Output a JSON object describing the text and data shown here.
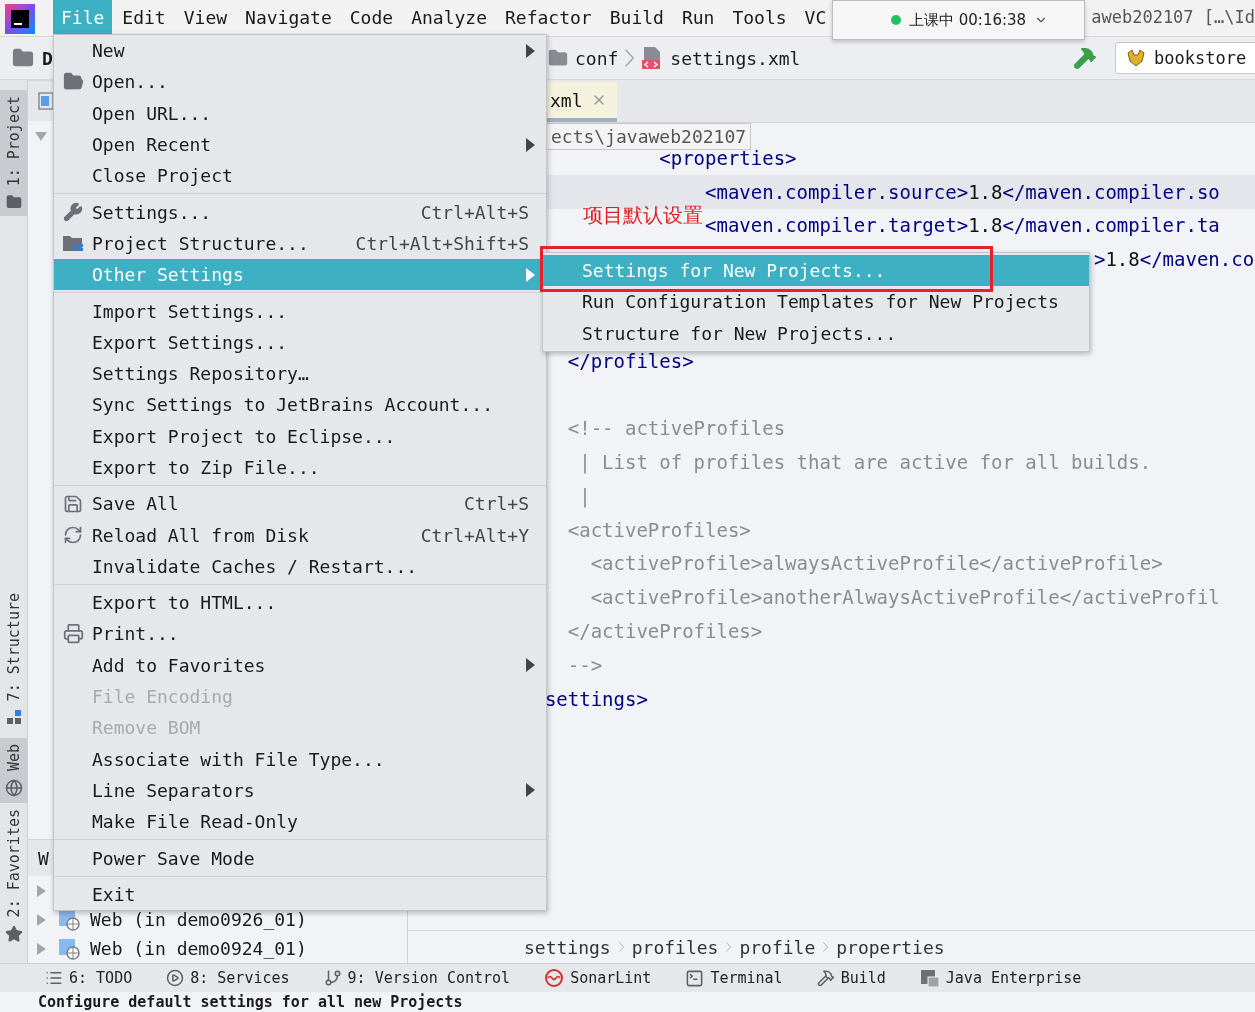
{
  "menu_bar": {
    "items": [
      {
        "label": "File",
        "selected": true
      },
      {
        "label": "Edit",
        "selected": false
      },
      {
        "label": "View",
        "selected": false
      },
      {
        "label": "Navigate",
        "selected": false
      },
      {
        "label": "Code",
        "selected": false
      },
      {
        "label": "Analyze",
        "selected": false
      },
      {
        "label": "Refactor",
        "selected": false
      },
      {
        "label": "Build",
        "selected": false
      },
      {
        "label": "Run",
        "selected": false
      },
      {
        "label": "Tools",
        "selected": false
      },
      {
        "label": "VC",
        "selected": false
      }
    ],
    "window_title": "aweb202107 […\\Id"
  },
  "notification": {
    "text": "上课中 00:16:38"
  },
  "nav_bar": {
    "project": "D",
    "crumbs": [
      "conf",
      "settings.xml"
    ],
    "run_config": "bookstore"
  },
  "tool_strip": [
    {
      "label": "1: Project",
      "kind": "project",
      "selected": true
    },
    {
      "label": "7: Structure",
      "kind": "structure",
      "selected": false
    },
    {
      "label": "Web",
      "kind": "web",
      "selected": true
    },
    {
      "label": "2: Favorites",
      "kind": "favorites",
      "selected": false
    }
  ],
  "project_window": {
    "nodes": [
      {
        "expanded": true
      }
    ]
  },
  "web_window": {
    "title": "W",
    "nodes": [
      {
        "expanded": false
      },
      {
        "label": "Web (in demo0926_01)",
        "expanded": false
      },
      {
        "label": "Web (in demo0924_01)",
        "expanded": false
      }
    ]
  },
  "editor": {
    "tabs": [
      {
        "label": "xml",
        "selected": true
      }
    ],
    "path_tooltip": "ects\\javaweb202107",
    "lines": [
      {
        "kind": "tag",
        "text": "            <properties>",
        "current": false
      },
      {
        "kind": "tag",
        "text": "                <maven.compiler.source>1.8</maven.compiler.so",
        "current": true
      },
      {
        "kind": "tag",
        "text": "                <maven.compiler.target>1.8</maven.compiler.ta",
        "current": false
      },
      {
        "kind": "tag",
        "text": "                                                  >1.8</maven.co",
        "current": false
      },
      {
        "kind": "blank",
        "current": false
      },
      {
        "kind": "blank",
        "current": false
      },
      {
        "kind": "tag",
        "text": "    </profiles>",
        "current": false
      },
      {
        "kind": "blank",
        "current": false
      },
      {
        "kind": "comment",
        "text": "    <!-- activeProfiles",
        "current": false
      },
      {
        "kind": "comment",
        "text": "     | List of profiles that are active for all builds.",
        "current": false
      },
      {
        "kind": "comment",
        "text": "     |",
        "current": false
      },
      {
        "kind": "comment",
        "text": "    <activeProfiles>",
        "current": false
      },
      {
        "kind": "comment",
        "text": "      <activeProfile>alwaysActiveProfile</activeProfile>",
        "current": false
      },
      {
        "kind": "comment",
        "text": "      <activeProfile>anotherAlwaysActiveProfile</activeProfil",
        "current": false
      },
      {
        "kind": "comment",
        "text": "    </activeProfiles>",
        "current": false
      },
      {
        "kind": "comment",
        "text": "    -->",
        "current": false
      },
      {
        "kind": "tag",
        "text": "  settings>",
        "current": false
      }
    ],
    "breadcrumbs": [
      "settings",
      "profiles",
      "profile",
      "properties"
    ]
  },
  "file_menu": {
    "groups": [
      {
        "items": [
          {
            "label": "New",
            "kind": "plain",
            "selected": false,
            "disabled": false,
            "submenu": true
          },
          {
            "label": "Open...",
            "kind": "open",
            "selected": false,
            "disabled": false,
            "submenu": false
          },
          {
            "label": "Open URL...",
            "kind": "plain",
            "selected": false,
            "disabled": false,
            "submenu": false
          },
          {
            "label": "Open Recent",
            "kind": "plain",
            "selected": false,
            "disabled": false,
            "submenu": true
          },
          {
            "label": "Close Project",
            "kind": "plain",
            "selected": false,
            "disabled": false,
            "submenu": false
          }
        ]
      },
      {
        "items": [
          {
            "label": "Settings...",
            "kind": "settings",
            "shortcut": "Ctrl+Alt+S",
            "selected": false,
            "disabled": false,
            "submenu": false
          },
          {
            "label": "Project Structure...",
            "kind": "structure",
            "shortcut": "Ctrl+Alt+Shift+S",
            "selected": false,
            "disabled": false,
            "submenu": false
          },
          {
            "label": "Other Settings",
            "kind": "plain",
            "selected": true,
            "disabled": false,
            "submenu": true
          }
        ]
      },
      {
        "items": [
          {
            "label": "Import Settings...",
            "kind": "plain",
            "selected": false,
            "disabled": false,
            "submenu": false
          },
          {
            "label": "Export Settings...",
            "kind": "plain",
            "selected": false,
            "disabled": false,
            "submenu": false
          },
          {
            "label": "Settings Repository…",
            "kind": "plain",
            "selected": false,
            "disabled": false,
            "submenu": false
          },
          {
            "label": "Sync Settings to JetBrains Account...",
            "kind": "plain",
            "selected": false,
            "disabled": false,
            "submenu": false
          },
          {
            "label": "Export Project to Eclipse...",
            "kind": "plain",
            "selected": false,
            "disabled": false,
            "submenu": false
          },
          {
            "label": "Export to Zip File...",
            "kind": "plain",
            "selected": false,
            "disabled": false,
            "submenu": false
          }
        ]
      },
      {
        "items": [
          {
            "label": "Save All",
            "kind": "save",
            "shortcut": "Ctrl+S",
            "selected": false,
            "disabled": false,
            "submenu": false
          },
          {
            "label": "Reload All from Disk",
            "kind": "reload",
            "shortcut": "Ctrl+Alt+Y",
            "selected": false,
            "disabled": false,
            "submenu": false
          },
          {
            "label": "Invalidate Caches / Restart...",
            "kind": "plain",
            "selected": false,
            "disabled": false,
            "submenu": false
          }
        ]
      },
      {
        "items": [
          {
            "label": "Export to HTML...",
            "kind": "plain",
            "selected": false,
            "disabled": false,
            "submenu": false
          },
          {
            "label": "Print...",
            "kind": "print",
            "selected": false,
            "disabled": false,
            "submenu": false
          },
          {
            "label": "Add to Favorites",
            "kind": "plain",
            "selected": false,
            "disabled": false,
            "submenu": true
          },
          {
            "label": "File Encoding",
            "kind": "plain",
            "selected": false,
            "disabled": true,
            "submenu": false
          },
          {
            "label": "Remove BOM",
            "kind": "plain",
            "selected": false,
            "disabled": true,
            "submenu": false
          },
          {
            "label": "Associate with File Type...",
            "kind": "plain",
            "selected": false,
            "disabled": false,
            "submenu": false
          },
          {
            "label": "Line Separators",
            "kind": "plain",
            "selected": false,
            "disabled": false,
            "submenu": true
          },
          {
            "label": "Make File Read-Only",
            "kind": "plain",
            "selected": false,
            "disabled": false,
            "submenu": false
          }
        ]
      },
      {
        "items": [
          {
            "label": "Power Save Mode",
            "kind": "plain",
            "selected": false,
            "disabled": false,
            "submenu": false
          }
        ]
      },
      {
        "items": [
          {
            "label": "Exit",
            "kind": "plain",
            "selected": false,
            "disabled": false,
            "submenu": false
          }
        ]
      }
    ]
  },
  "submenu": {
    "items": [
      {
        "label": "Settings for New Projects...",
        "selected": true
      },
      {
        "label": "Run Configuration Templates for New Projects",
        "selected": false
      },
      {
        "label": "Structure for New Projects...",
        "selected": false
      }
    ]
  },
  "annotation": {
    "text": "项目默认设置"
  },
  "tool_windows": [
    {
      "label": "6: TODO",
      "kind": "todo"
    },
    {
      "label": "8: Services",
      "kind": "services"
    },
    {
      "label": "9: Version Control",
      "kind": "version_control"
    },
    {
      "label": "SonarLint",
      "kind": "sonarlint"
    },
    {
      "label": "Terminal",
      "kind": "terminal"
    },
    {
      "label": "Build",
      "kind": "build"
    },
    {
      "label": "Java Enterprise",
      "kind": "java_enterprise"
    }
  ],
  "status_bar": {
    "text": "Configure default settings for all new Projects"
  }
}
